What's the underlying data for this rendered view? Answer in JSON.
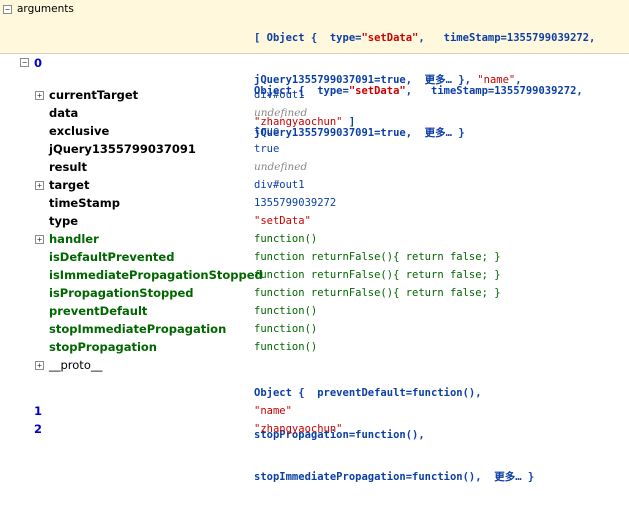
{
  "header": {
    "name": "arguments",
    "line1_a": "[ Object {  type=",
    "line1_str": "\"setData\"",
    "line1_b": ",   timeStamp=1355799039272,",
    "line2_a": "jQuery1355799037091=true,  更多… }, ",
    "line2_str": "\"name\"",
    "line2_b": ",",
    "line3_str": "\"zhangyaochun\"",
    "line3_b": " ]"
  },
  "item0": {
    "index": "0",
    "line1_a": "Object {  type=",
    "line1_str": "\"setData\"",
    "line1_b": ",   timeStamp=1355799039272,",
    "line2": "jQuery1355799037091=true,  更多… }"
  },
  "props": [
    {
      "name": "currentTarget",
      "value": "div#out1"
    },
    {
      "name": "data",
      "value": "undefined"
    },
    {
      "name": "exclusive",
      "value": "true"
    },
    {
      "name": "jQuery1355799037091",
      "value": "true"
    },
    {
      "name": "result",
      "value": "undefined"
    },
    {
      "name": "target",
      "value": "div#out1"
    },
    {
      "name": "timeStamp",
      "value": "1355799039272"
    },
    {
      "name": "type",
      "value": "\"setData\""
    },
    {
      "name": "handler",
      "value": "function()"
    },
    {
      "name": "isDefaultPrevented",
      "value": "function returnFalse(){ return false; }"
    },
    {
      "name": "isImmediatePropagationStopped",
      "value": "function returnFalse(){ return false; }"
    },
    {
      "name": "isPropagationStopped",
      "value": "function returnFalse(){ return false; }"
    },
    {
      "name": "preventDefault",
      "value": "function()"
    },
    {
      "name": "stopImmediatePropagation",
      "value": "function()"
    },
    {
      "name": "stopPropagation",
      "value": "function()"
    }
  ],
  "proto": {
    "name": "__proto__",
    "line1": "Object {  preventDefault=function(),",
    "line2": "stopPropagation=function(),",
    "line3": "stopImmediatePropagation=function(),  更多… }"
  },
  "item1": {
    "index": "1",
    "value": "\"name\""
  },
  "item2": {
    "index": "2",
    "value": "\"zhangyaochun\""
  },
  "toggles": {
    "expanded": "−",
    "collapsed": "+"
  }
}
